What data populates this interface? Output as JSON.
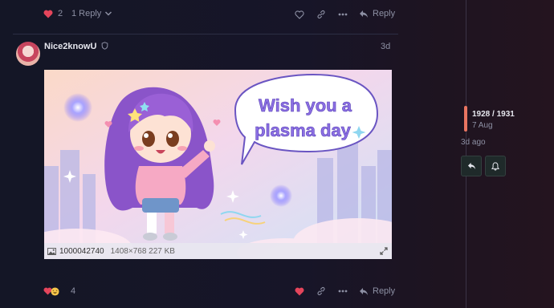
{
  "top_post": {
    "like_count": "2",
    "replies_label": "1 Reply",
    "reply_label": "Reply"
  },
  "post": {
    "username": "Nice2knowU",
    "date": "3d",
    "image": {
      "speech_bubble_line1": "Wish you a",
      "speech_bubble_line2": "plasma day",
      "filename": "1000042740",
      "meta": "1408×768 227 KB"
    },
    "reaction_count": "4",
    "reply_label": "Reply"
  },
  "timeline": {
    "position": "1928 / 1931",
    "date": "7 Aug",
    "ago": "3d ago"
  },
  "colors": {
    "like_red": "#e4455b",
    "accent": "#e97561"
  }
}
